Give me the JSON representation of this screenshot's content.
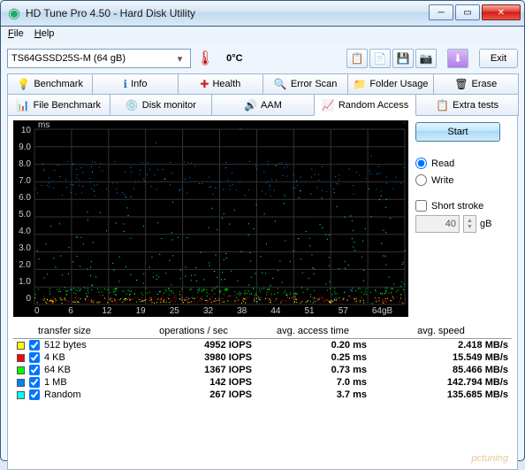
{
  "window": {
    "title": "HD Tune Pro 4.50 - Hard Disk Utility"
  },
  "menu": {
    "file": "File",
    "help": "Help"
  },
  "device": {
    "selected": "TS64GSSD25S-M (64 gB)",
    "temp": "0°C"
  },
  "toolbar": {
    "exit": "Exit"
  },
  "tabs": {
    "row1": [
      "Benchmark",
      "Info",
      "Health",
      "Error Scan",
      "Folder Usage",
      "Erase"
    ],
    "row2": [
      "File Benchmark",
      "Disk monitor",
      "AAM",
      "Random Access",
      "Extra tests"
    ],
    "active": "Random Access"
  },
  "side": {
    "start": "Start",
    "read": "Read",
    "write": "Write",
    "short_stroke": "Short stroke",
    "stroke_val": "40",
    "stroke_unit": "gB"
  },
  "chart_data": {
    "type": "scatter",
    "title": "",
    "xlabel": "gB",
    "ylabel": "ms",
    "xlim": [
      0,
      64
    ],
    "ylim": [
      0,
      10
    ],
    "xticks": [
      0,
      6,
      12,
      19,
      25,
      32,
      38,
      44,
      51,
      57,
      "64gB"
    ],
    "yticks": [
      "10",
      "9.0",
      "8.0",
      "7.0",
      "6.0",
      "5.0",
      "4.0",
      "3.0",
      "2.0",
      "1.0",
      "0"
    ],
    "series": [
      {
        "name": "512 bytes",
        "color": "#ffff00",
        "avg_ms": 0.2,
        "band": [
          0.1,
          0.4
        ]
      },
      {
        "name": "4 KB",
        "color": "#ff0000",
        "avg_ms": 0.25,
        "band": [
          0.15,
          0.45
        ]
      },
      {
        "name": "64 KB",
        "color": "#00ff00",
        "avg_ms": 0.73,
        "band": [
          0.55,
          0.95
        ]
      },
      {
        "name": "1 MB",
        "color": "#0080ff",
        "avg_ms": 7.0,
        "band": [
          6.2,
          8.2
        ]
      },
      {
        "name": "Random",
        "color": "#00ffff",
        "avg_ms": 3.7,
        "band": [
          0.3,
          8.5
        ]
      }
    ]
  },
  "results": {
    "headers": [
      "transfer size",
      "operations / sec",
      "avg. access time",
      "avg. speed"
    ],
    "rows": [
      {
        "color": "#ffff00",
        "label": "512 bytes",
        "iops": "4952 IOPS",
        "access": "0.20 ms",
        "speed": "2.418 MB/s"
      },
      {
        "color": "#ff0000",
        "label": "4 KB",
        "iops": "3980 IOPS",
        "access": "0.25 ms",
        "speed": "15.549 MB/s"
      },
      {
        "color": "#00ff00",
        "label": "64 KB",
        "iops": "1367 IOPS",
        "access": "0.73 ms",
        "speed": "85.466 MB/s"
      },
      {
        "color": "#0080ff",
        "label": "1 MB",
        "iops": "142 IOPS",
        "access": "7.0 ms",
        "speed": "142.794 MB/s"
      },
      {
        "color": "#00ffff",
        "label": "Random",
        "iops": "267 IOPS",
        "access": "3.7 ms",
        "speed": "135.685 MB/s"
      }
    ]
  },
  "watermark": "pctuning"
}
